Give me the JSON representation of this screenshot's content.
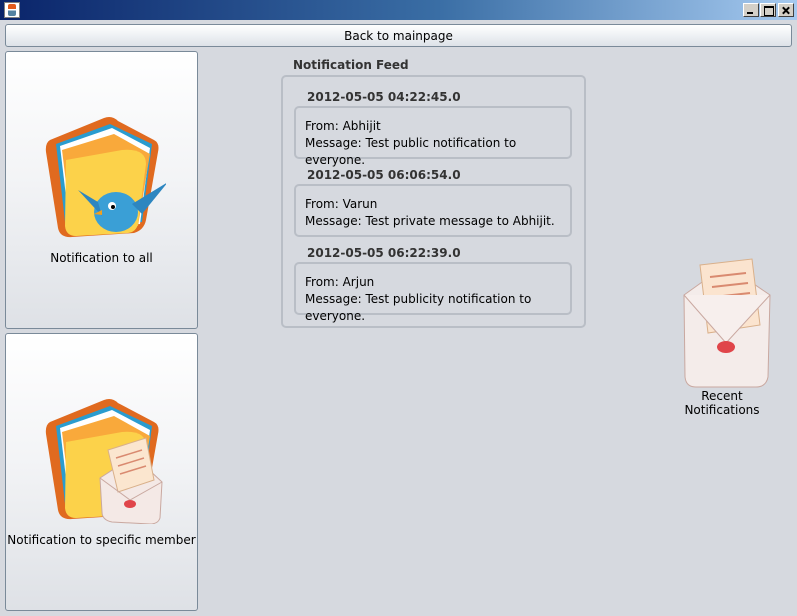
{
  "window": {
    "title": "",
    "icon": "java-cup-icon",
    "controls": [
      "minimize-icon",
      "maximize-icon",
      "close-icon"
    ]
  },
  "toolbar": {
    "back_label": "Back to mainpage"
  },
  "sidebar": {
    "items": [
      {
        "label": "Notification to all",
        "icon": "folder-bird-icon"
      },
      {
        "label": "Notification to specific member",
        "icon": "folder-envelope-icon"
      }
    ]
  },
  "feed": {
    "title": "Notification Feed",
    "entries": [
      {
        "date": "2012-05-05 04:22:45.0",
        "from": "From: Abhijit",
        "message": "Message: Test public notification to everyone."
      },
      {
        "date": "2012-05-05 06:06:54.0",
        "from": "From: Varun",
        "message": "Message: Test private message to Abhijit."
      },
      {
        "date": "2012-05-05 06:22:39.0",
        "from": "From: Arjun",
        "message": "Message: Test publicity notification to everyone."
      }
    ]
  },
  "recent": {
    "label": "Recent Notifications",
    "icon": "envelope-letter-icon"
  },
  "colors": {
    "title_start": "#0a246a",
    "title_end": "#a6caf0",
    "background": "#d6d9df",
    "border": "#b9bec6"
  }
}
